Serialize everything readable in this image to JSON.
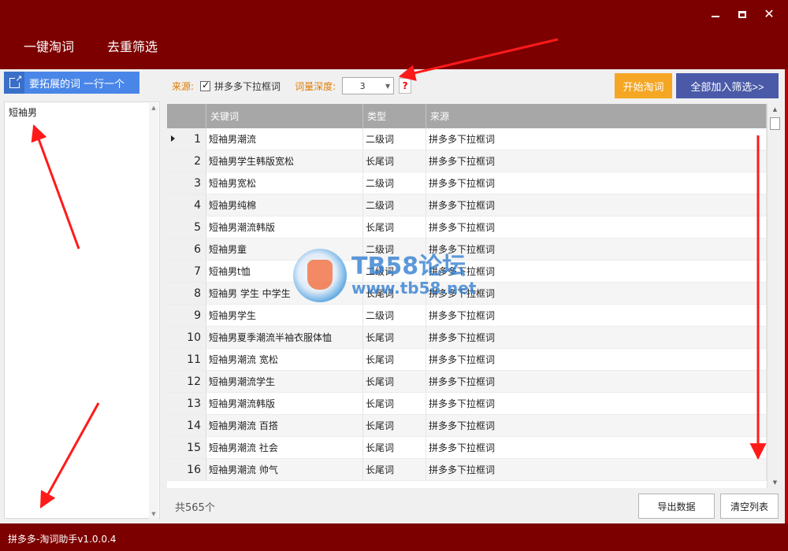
{
  "window": {
    "tabs": [
      {
        "label": "一键淘词",
        "active": true
      },
      {
        "label": "去重筛选",
        "active": false
      }
    ],
    "status_text": "拼多多-淘词助手v1.0.0.4"
  },
  "seed_panel": {
    "header_label": "要拓展的词 一行一个",
    "icon": "external-link-icon",
    "content": "短袖男"
  },
  "toolbar": {
    "source_label": "来源:",
    "source_option": {
      "label": "拼多多下拉框词",
      "checked": true
    },
    "depth_label": "词量深度:",
    "depth_value": "3",
    "help_label": "?",
    "start_label": "开始淘词",
    "add_all_label": "全部加入筛选>>"
  },
  "grid": {
    "columns": [
      "关键词",
      "类型",
      "来源"
    ],
    "rows": [
      {
        "n": "1",
        "keyword": "短袖男潮流",
        "type": "二级词",
        "source": "拼多多下拉框词"
      },
      {
        "n": "2",
        "keyword": "短袖男学生韩版宽松",
        "type": "长尾词",
        "source": "拼多多下拉框词"
      },
      {
        "n": "3",
        "keyword": "短袖男宽松",
        "type": "二级词",
        "source": "拼多多下拉框词"
      },
      {
        "n": "4",
        "keyword": "短袖男纯棉",
        "type": "二级词",
        "source": "拼多多下拉框词"
      },
      {
        "n": "5",
        "keyword": "短袖男潮流韩版",
        "type": "长尾词",
        "source": "拼多多下拉框词"
      },
      {
        "n": "6",
        "keyword": "短袖男童",
        "type": "二级词",
        "source": "拼多多下拉框词"
      },
      {
        "n": "7",
        "keyword": "短袖男t恤",
        "type": "二级词",
        "source": "拼多多下拉框词"
      },
      {
        "n": "8",
        "keyword": "短袖男 学生 中学生",
        "type": "长尾词",
        "source": "拼多多下拉框词"
      },
      {
        "n": "9",
        "keyword": "短袖男学生",
        "type": "二级词",
        "source": "拼多多下拉框词"
      },
      {
        "n": "10",
        "keyword": "短袖男夏季潮流半袖衣服体恤",
        "type": "长尾词",
        "source": "拼多多下拉框词"
      },
      {
        "n": "11",
        "keyword": "短袖男潮流 宽松",
        "type": "长尾词",
        "source": "拼多多下拉框词"
      },
      {
        "n": "12",
        "keyword": "短袖男潮流学生",
        "type": "长尾词",
        "source": "拼多多下拉框词"
      },
      {
        "n": "13",
        "keyword": "短袖男潮流韩版",
        "type": "长尾词",
        "source": "拼多多下拉框词"
      },
      {
        "n": "14",
        "keyword": "短袖男潮流 百搭",
        "type": "长尾词",
        "source": "拼多多下拉框词"
      },
      {
        "n": "15",
        "keyword": "短袖男潮流 社会",
        "type": "长尾词",
        "source": "拼多多下拉框词"
      },
      {
        "n": "16",
        "keyword": "短袖男潮流 帅气",
        "type": "长尾词",
        "source": "拼多多下拉框词"
      }
    ]
  },
  "footer": {
    "total_label": "共565个",
    "export_label": "导出数据",
    "clear_label": "清空列表"
  },
  "watermark": {
    "title": "TB58论坛",
    "url": "www.tb58.net"
  },
  "colors": {
    "window_bg": "#7d0000",
    "accent_blue": "#4a86e8",
    "start_btn": "#f5a623",
    "add_all_btn": "#4a5aa8",
    "annotation_red": "#ff1a1a"
  }
}
